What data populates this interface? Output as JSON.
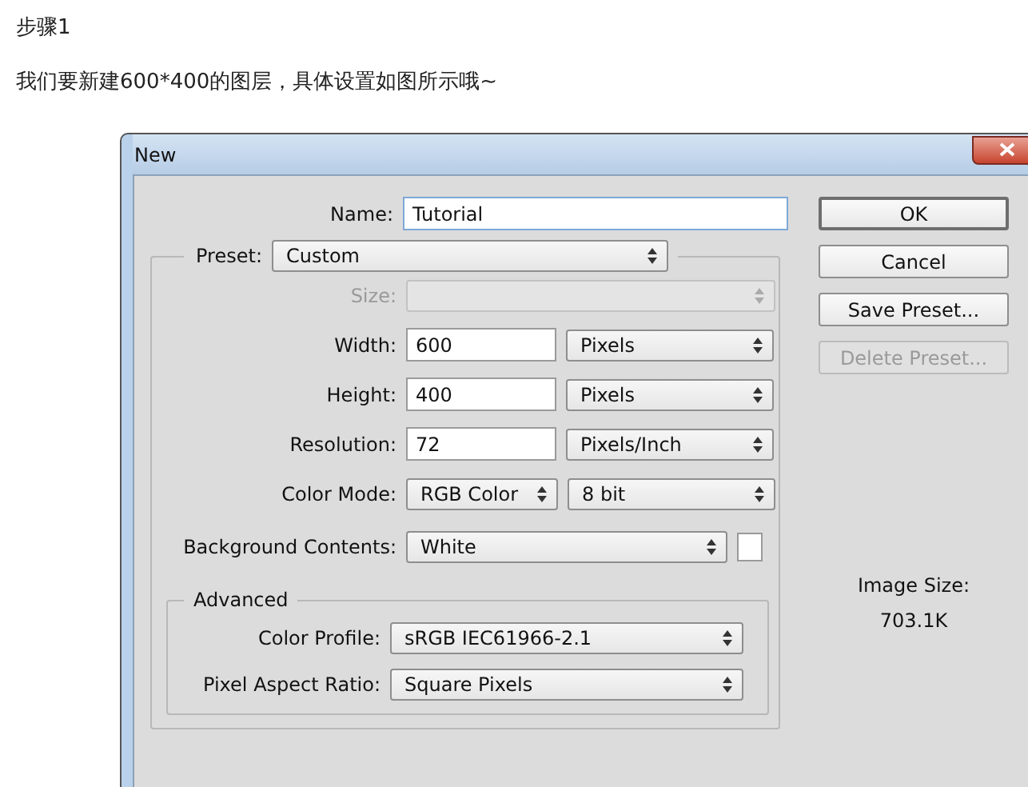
{
  "article": {
    "step_title": "步骤1",
    "intro": "我们要新建600*400的图层，具体设置如图所示哦~"
  },
  "dialog": {
    "title": "New",
    "name": {
      "label": "Name:",
      "value": "Tutorial"
    },
    "preset": {
      "label": "Preset:",
      "value": "Custom"
    },
    "fields": [
      {
        "kind": "select",
        "label": "Size:",
        "disabled": true
      },
      {
        "kind": "input-unit",
        "label": "Width:",
        "value": "600",
        "unit": "Pixels",
        "disabled": false
      },
      {
        "kind": "input-unit",
        "label": "Height:",
        "value": "400",
        "unit": "Pixels",
        "disabled": false
      },
      {
        "kind": "input-unit",
        "label": "Resolution:",
        "value": "72",
        "unit": "Pixels/Inch",
        "disabled": false
      },
      {
        "kind": "dual-select",
        "label": "Color Mode:",
        "value": "RGB Color",
        "unit": "8 bit",
        "disabled": false
      }
    ],
    "background": {
      "label": "Background Contents:",
      "value": "White"
    },
    "advanced": {
      "label": "Advanced",
      "fields": [
        {
          "label": "Color Profile:",
          "value": "sRGB IEC61966-2.1"
        },
        {
          "label": "Pixel Aspect Ratio:",
          "value": "Square Pixels"
        }
      ]
    },
    "buttons": [
      {
        "label": "OK",
        "default": true,
        "disabled": false
      },
      {
        "label": "Cancel",
        "default": false,
        "disabled": false
      },
      {
        "label": "Save Preset...",
        "default": false,
        "disabled": false
      },
      {
        "label": "Delete Preset...",
        "default": false,
        "disabled": true
      }
    ],
    "image_size": {
      "label": "Image Size:",
      "value": "703.1K"
    }
  }
}
